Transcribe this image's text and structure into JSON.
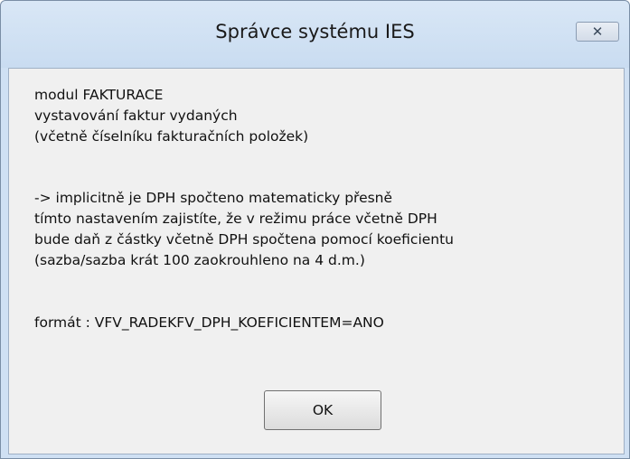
{
  "window": {
    "title": "Správce systému IES",
    "close_glyph": "✕"
  },
  "message": {
    "lines": [
      "modul FAKTURACE",
      "vystavování faktur vydaných",
      "(včetně číselníku fakturačních položek)",
      "",
      "-> implicitně je DPH spočteno matematicky přesně",
      "tímto nastavením zajistíte, že v režimu práce včetně DPH",
      "bude daň z částky včetně DPH spočtena pomocí koeficientu",
      "(sazba/sazba krát 100 zaokrouhleno na 4 d.m.)",
      "",
      "formát : VFV_RADEKFV_DPH_KOEFICIENTEM=ANO"
    ]
  },
  "buttons": {
    "ok_label": "OK"
  },
  "colors": {
    "frame": "#cfe0f3",
    "client_background": "#f0f0f0"
  }
}
